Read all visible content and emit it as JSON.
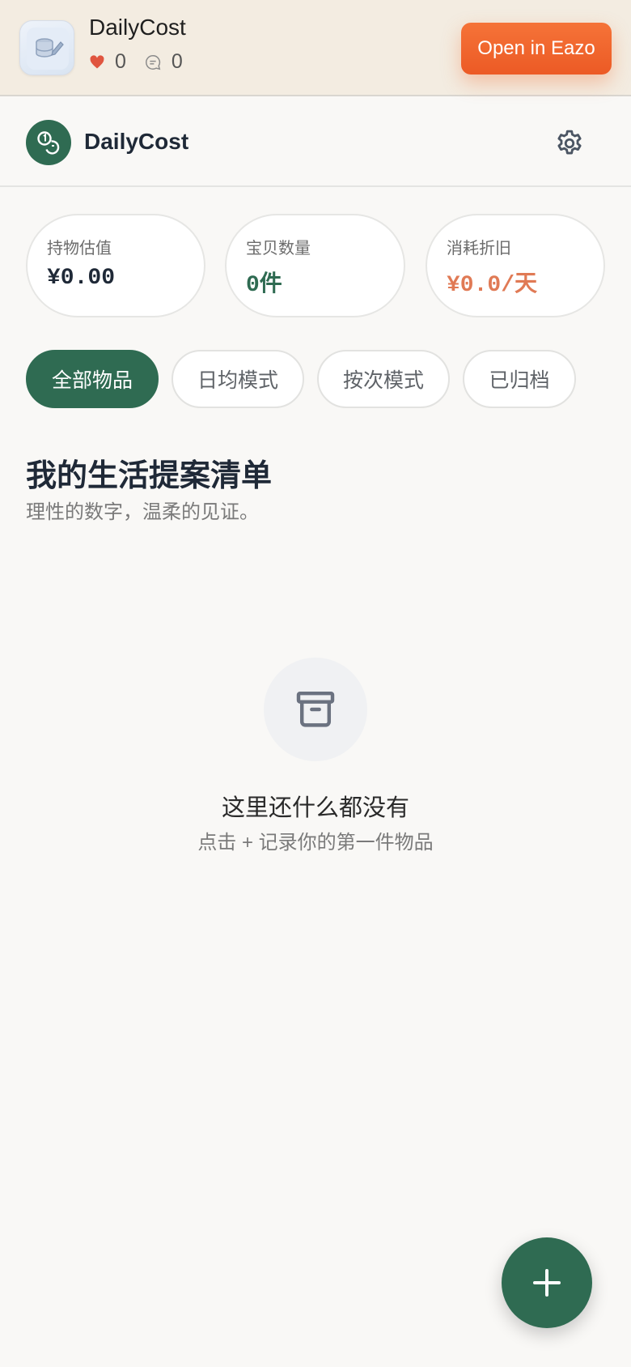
{
  "promo": {
    "app_name": "DailyCost",
    "likes": "0",
    "comments": "0",
    "open_button": "Open in Eazo",
    "icons": {
      "app": "app-coins-icon",
      "like": "heart-icon",
      "comment": "comment-icon"
    },
    "colors": {
      "heart": "#e0553f",
      "button": "#f06a30"
    }
  },
  "header": {
    "title": "DailyCost",
    "icons": {
      "logo": "coins-logo-icon",
      "settings": "gear-icon"
    },
    "colors": {
      "brand": "#2f6b52"
    }
  },
  "stats": [
    {
      "label": "持物估值",
      "value": "¥0.00"
    },
    {
      "label": "宝贝数量",
      "value": "0件"
    },
    {
      "label": "消耗折旧",
      "value": "¥0.0/天"
    }
  ],
  "tabs": [
    {
      "label": "全部物品",
      "active": true
    },
    {
      "label": "日均模式",
      "active": false
    },
    {
      "label": "按次模式",
      "active": false
    },
    {
      "label": "已归档",
      "active": false
    }
  ],
  "section": {
    "title": "我的生活提案清单",
    "subtitle": "理性的数字，温柔的见证。"
  },
  "empty_state": {
    "icon": "archive-box-icon",
    "title": "这里还什么都没有",
    "subtitle": "点击 + 记录你的第一件物品"
  },
  "fab": {
    "icon": "plus-icon"
  }
}
